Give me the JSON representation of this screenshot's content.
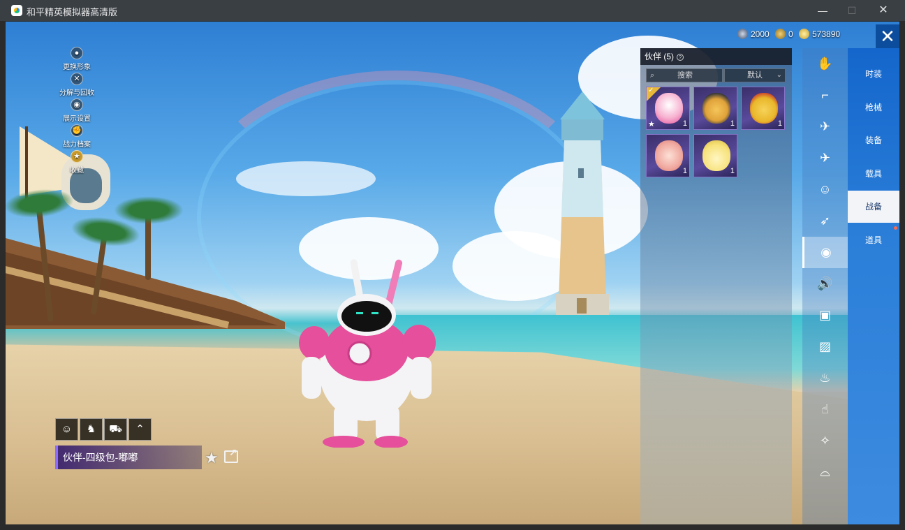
{
  "window": {
    "title": "和平精英模拟器高清版",
    "minimize": "—",
    "maximize": "☐",
    "close": "✕"
  },
  "currency": [
    {
      "icon": "coin-icon",
      "value": "2000"
    },
    {
      "icon": "medal-icon",
      "value": "0"
    },
    {
      "icon": "gold-icon",
      "value": "573890"
    }
  ],
  "left_menu": [
    {
      "icon": "user-icon",
      "label": "更换形象"
    },
    {
      "icon": "tool-icon",
      "label": "分解与回收"
    },
    {
      "icon": "eye-icon",
      "label": "展示设置"
    },
    {
      "icon": "fist-icon",
      "label": "战力档案"
    },
    {
      "icon": "badge-icon",
      "label": "收藏"
    }
  ],
  "action_bar": [
    {
      "icon": "emote-icon",
      "glyph": "☺"
    },
    {
      "icon": "pose-icon",
      "glyph": "♞"
    },
    {
      "icon": "vehicle-icon",
      "glyph": "⛟"
    },
    {
      "icon": "chevron-up-icon",
      "glyph": "⌃"
    }
  ],
  "selected_item": {
    "name": "伙伴-四级包-嘟嘟"
  },
  "inventory": {
    "header": "伙伴 (5)",
    "help": "?",
    "search_label": "搜索",
    "sort_label": "默认",
    "items": [
      {
        "qty": "1",
        "color": "#f7b3d1",
        "equipped": true,
        "starred": true
      },
      {
        "qty": "1",
        "color": "#e0a23a",
        "equipped": false,
        "starred": false
      },
      {
        "qty": "1",
        "color": "#e8b62a",
        "equipped": false,
        "starred": false
      },
      {
        "qty": "1",
        "color": "#f0a9a0",
        "equipped": false,
        "starred": false
      },
      {
        "qty": "1",
        "color": "#f7e27a",
        "equipped": false,
        "starred": false
      }
    ]
  },
  "icon_rail": [
    {
      "icon": "hand-icon",
      "glyph": "✋"
    },
    {
      "icon": "rifle-icon",
      "glyph": "⌐"
    },
    {
      "icon": "drone-icon",
      "glyph": "✈"
    },
    {
      "icon": "plane-icon",
      "glyph": "✈"
    },
    {
      "icon": "face-icon",
      "glyph": "☺"
    },
    {
      "icon": "glider-icon",
      "glyph": "➶"
    },
    {
      "icon": "companion-icon",
      "glyph": "◉"
    },
    {
      "icon": "speaker-icon",
      "glyph": "🔊"
    },
    {
      "icon": "card-icon",
      "glyph": "▣"
    },
    {
      "icon": "gallery-icon",
      "glyph": "▨"
    },
    {
      "icon": "extinguisher-icon",
      "glyph": "♨"
    },
    {
      "icon": "tap-icon",
      "glyph": "☝"
    },
    {
      "icon": "sparkle-icon",
      "glyph": "✧"
    },
    {
      "icon": "hat-icon",
      "glyph": "⌓"
    }
  ],
  "categories": [
    {
      "label": "时装",
      "active": false
    },
    {
      "label": "枪械",
      "active": false
    },
    {
      "label": "装备",
      "active": false
    },
    {
      "label": "载具",
      "active": false
    },
    {
      "label": "战备",
      "active": true
    },
    {
      "label": "道具",
      "active": false,
      "notify": true
    }
  ],
  "close_glyph": "✕",
  "colors": {
    "category_rail": "#1466cc",
    "name_plate_accent": "#8a6cff",
    "equipped_badge": "#e8b93a"
  }
}
